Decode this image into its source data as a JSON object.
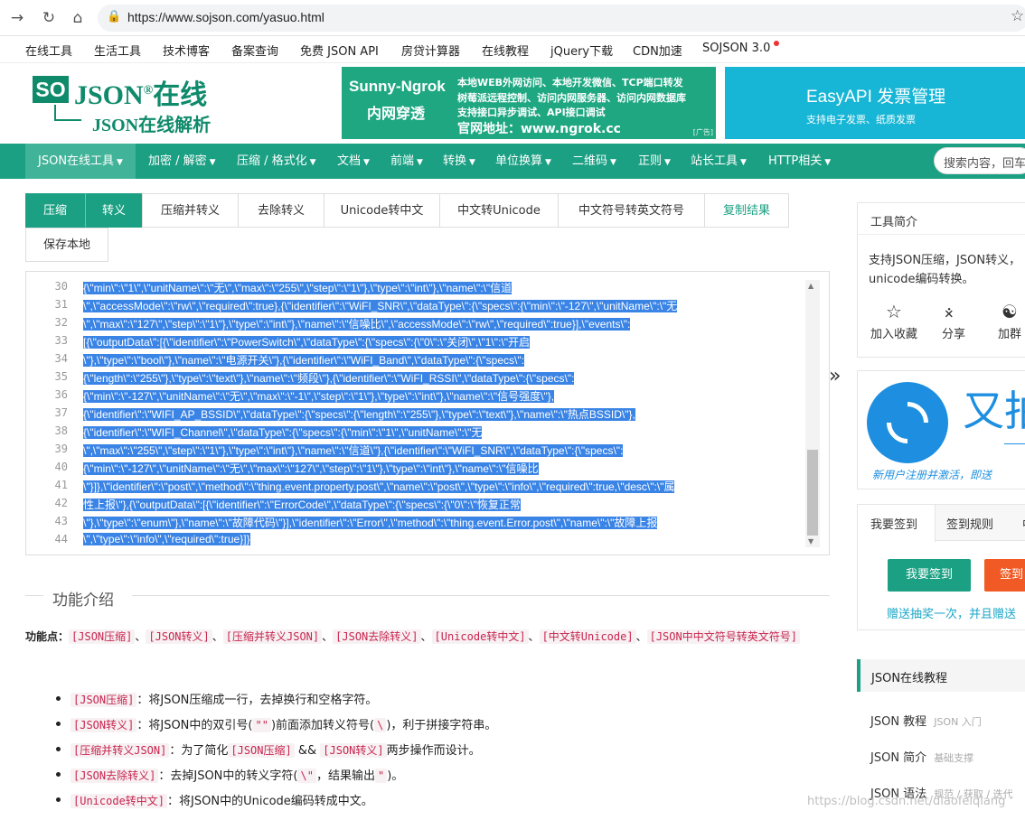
{
  "browser": {
    "url": "https://www.sojson.com/yasuo.html"
  },
  "toplinks": [
    "在线工具",
    "生活工具",
    "技术博客",
    "备案查询",
    "免费 JSON API",
    "房贷计算器",
    "在线教程",
    "jQuery下载",
    "CDN加速",
    "SOJSON 3.0"
  ],
  "logo": {
    "so": "SO",
    "json": "JSON",
    "reg": "®",
    "zaixian": "在线",
    "sub": "JSON在线解析"
  },
  "ad1": {
    "title": "Sunny-Ngrok",
    "subtitle": "内网穿透",
    "lines": [
      "本地WEB外网访问、本地开发微信、TCP端口转发",
      "树莓派远程控制、访问内网服务器、访问内网数据库",
      "支持接口异步调试、API接口调试",
      "官网地址：www.ngrok.cc"
    ],
    "tag": "广告"
  },
  "ad2": {
    "title": "EasyAPI 发票管理",
    "subtitle": "支持电子发票、纸质发票"
  },
  "mainnav": {
    "items": [
      "JSON在线工具",
      "加密 / 解密",
      "压缩 / 格式化",
      "文档",
      "前端",
      "转换",
      "单位换算",
      "二维码",
      "正则",
      "站长工具",
      "HTTP相关"
    ],
    "search_placeholder": "搜索内容，回车"
  },
  "tools": {
    "buttons": [
      "压缩",
      "转义",
      "压缩并转义",
      "去除转义",
      "Unicode转中文",
      "中文转Unicode",
      "中文符号转英文符号",
      "复制结果",
      "保存本地"
    ]
  },
  "editor": {
    "line_numbers": [
      "30",
      "31",
      "32",
      "33",
      "34",
      "35",
      "36",
      "37",
      "38",
      "39",
      "40",
      "41",
      "42",
      "43",
      "44"
    ],
    "lines": [
      "{\\\"min\\\":\\\"1\\\",\\\"unitName\\\":\\\"无\\\",\\\"max\\\":\\\"255\\\",\\\"step\\\":\\\"1\\\"},\\\"type\\\":\\\"int\\\"},\\\"name\\\":\\\"信道",
      "\\\",\\\"accessMode\\\":\\\"rw\\\",\\\"required\\\":true},{\\\"identifier\\\":\\\"WiFI_SNR\\\",\\\"dataType\\\":{\\\"specs\\\":{\\\"min\\\":\\\"-127\\\",\\\"unitName\\\":\\\"无",
      "\\\",\\\"max\\\":\\\"127\\\",\\\"step\\\":\\\"1\\\"},\\\"type\\\":\\\"int\\\"},\\\"name\\\":\\\"信噪比\\\",\\\"accessMode\\\":\\\"rw\\\",\\\"required\\\":true}],\\\"events\\\":",
      "[{\\\"outputData\\\":[{\\\"identifier\\\":\\\"PowerSwitch\\\",\\\"dataType\\\":{\\\"specs\\\":{\\\"0\\\":\\\"关闭\\\",\\\"1\\\":\\\"开启",
      "\\\"},\\\"type\\\":\\\"bool\\\"},\\\"name\\\":\\\"电源开关\\\"},{\\\"identifier\\\":\\\"WiFI_Band\\\",\\\"dataType\\\":{\\\"specs\\\":",
      "{\\\"length\\\":\\\"255\\\"},\\\"type\\\":\\\"text\\\"},\\\"name\\\":\\\"频段\\\"},{\\\"identifier\\\":\\\"WiFI_RSSI\\\",\\\"dataType\\\":{\\\"specs\\\":",
      "{\\\"min\\\":\\\"-127\\\",\\\"unitName\\\":\\\"无\\\",\\\"max\\\":\\\"-1\\\",\\\"step\\\":\\\"1\\\"},\\\"type\\\":\\\"int\\\"},\\\"name\\\":\\\"信号强度\\\"},",
      "{\\\"identifier\\\":\\\"WIFI_AP_BSSID\\\",\\\"dataType\\\":{\\\"specs\\\":{\\\"length\\\":\\\"255\\\"},\\\"type\\\":\\\"text\\\"},\\\"name\\\":\\\"热点BSSID\\\"},",
      "{\\\"identifier\\\":\\\"WIFI_Channel\\\",\\\"dataType\\\":{\\\"specs\\\":{\\\"min\\\":\\\"1\\\",\\\"unitName\\\":\\\"无",
      "\\\",\\\"max\\\":\\\"255\\\",\\\"step\\\":\\\"1\\\"},\\\"type\\\":\\\"int\\\"},\\\"name\\\":\\\"信道\\\"},{\\\"identifier\\\":\\\"WiFI_SNR\\\",\\\"dataType\\\":{\\\"specs\\\":",
      "{\\\"min\\\":\\\"-127\\\",\\\"unitName\\\":\\\"无\\\",\\\"max\\\":\\\"127\\\",\\\"step\\\":\\\"1\\\"},\\\"type\\\":\\\"int\\\"},\\\"name\\\":\\\"信噪比",
      "\\\"}]},\\\"identifier\\\":\\\"post\\\",\\\"method\\\":\\\"thing.event.property.post\\\",\\\"name\\\":\\\"post\\\",\\\"type\\\":\\\"info\\\",\\\"required\\\":true,\\\"desc\\\":\\\"属",
      "性上报\\\"},{\\\"outputData\\\":[{\\\"identifier\\\":\\\"ErrorCode\\\",\\\"dataType\\\":{\\\"specs\\\":{\\\"0\\\":\\\"恢复正常",
      "\\\"},\\\"type\\\":\\\"enum\\\"},\\\"name\\\":\\\"故障代码\\\"}],\\\"identifier\\\":\\\"Error\\\",\\\"method\\\":\\\"thing.event.Error.post\\\",\\\"name\\\":\\\"故障上报",
      "\\\",\\\"type\\\":\\\"info\\\",\\\"required\\\":true}]}"
    ]
  },
  "intro": {
    "title": "功能介绍",
    "points_label": "功能点：",
    "points": [
      "[JSON压缩]",
      "[JSON转义]",
      "[压缩并转义JSON]",
      "[JSON去除转义]",
      "[Unicode转中文]",
      "[中文转Unicode]",
      "[JSON中中文符号转英文符号]"
    ],
    "sep": "、",
    "features": [
      {
        "code": "[JSON压缩]",
        "text": "：将JSON压缩成一行，去掉换行和空格字符。"
      },
      {
        "code": "[JSON转义]",
        "text": "：将JSON中的双引号(",
        "code2": "\"\"",
        "text2": ")前面添加转义符号(",
        "code3": "\\",
        "text3": ")，利于拼接字符串。"
      },
      {
        "code": "[压缩并转义JSON]",
        "text": "：为了简化",
        "code2": "[JSON压缩]",
        "text2": " && ",
        "code3": "[JSON转义]",
        "text3": "两步操作而设计。"
      },
      {
        "code": "[JSON去除转义]",
        "text": "：去掉JSON中的转义字符(",
        "code2": "\\\"",
        "text2": "，结果输出",
        "code3": "\"",
        "text3": ")。"
      },
      {
        "code": "[Unicode转中文]",
        "text": "：将JSON中的Unicode编码转成中文。"
      }
    ]
  },
  "sidebar": {
    "intro_title": "工具简介",
    "intro_text": [
      "支持JSON压缩，JSON转义，",
      "unicode编码转换。"
    ],
    "actions": [
      "加入收藏",
      "分享",
      "加群"
    ],
    "ad_text": "又拍",
    "ad_sub": "新用户注册并激活，即送",
    "tabs": [
      "我要签到",
      "签到规则",
      "中"
    ],
    "signin_btn": "我要签到",
    "signin_btn2": "签到",
    "signin_link": "赠送抽奖一次，并且赠送",
    "tutorial_title": "JSON在线教程",
    "tutorials": [
      {
        "name": "JSON 教程",
        "tag": "JSON 入门"
      },
      {
        "name": "JSON 简介",
        "tag": "基础支撑"
      },
      {
        "name": "JSON 语法",
        "tag": "规范 / 获取 / 迭代"
      }
    ]
  },
  "watermark": "https://blog.csdn.net/diaofeiqiang"
}
